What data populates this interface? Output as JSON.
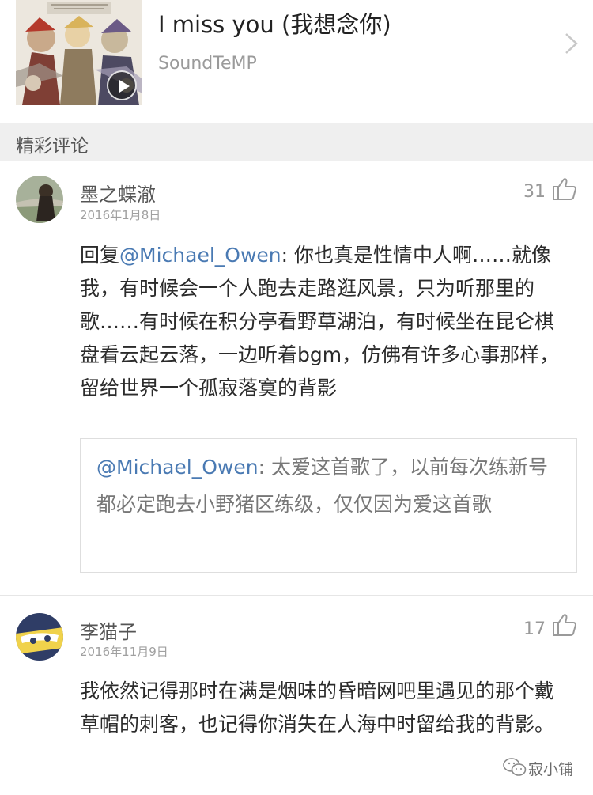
{
  "song": {
    "title": "I miss you (我想念你)",
    "artist": "SoundTeMP"
  },
  "section": {
    "title": "精彩评论"
  },
  "comments": [
    {
      "username": "墨之蝶澈",
      "date": "2016年1月8日",
      "likes": "31",
      "reply_prefix": "回复",
      "mention": "@Michael_Owen",
      "text": ": 你也真是性情中人啊……就像我，有时候会一个人跑去走路逛风景，只为听那里的歌……有时候在积分亭看野草湖泊，有时候坐在昆仑棋盘看云起云落，一边听着bgm，仿佛有许多心事那样，留给世界一个孤寂落寞的背影",
      "quoted": {
        "mention": "@Michael_Owen",
        "text": ": 太爱这首歌了，以前每次练新号都必定跑去小野猪区练级，仅仅因为爱这首歌"
      }
    },
    {
      "username": "李猫子",
      "date": "2016年11月9日",
      "likes": "17",
      "text": "我依然记得那时在满是烟味的昏暗网吧里遇见的那个戴草帽的刺客，也记得你消失在人海中时留给我的背影。"
    }
  ],
  "watermark": {
    "text": "寂小铺"
  }
}
